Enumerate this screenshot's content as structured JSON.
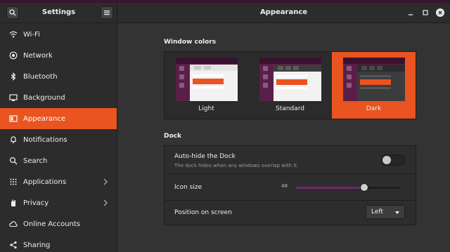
{
  "sidebar": {
    "title": "Settings",
    "items": [
      {
        "label": "Wi-Fi",
        "icon": "wifi-icon"
      },
      {
        "label": "Network",
        "icon": "network-icon"
      },
      {
        "label": "Bluetooth",
        "icon": "bluetooth-icon"
      },
      {
        "label": "Background",
        "icon": "background-icon"
      },
      {
        "label": "Appearance",
        "icon": "appearance-icon",
        "active": true
      },
      {
        "label": "Notifications",
        "icon": "bell-icon"
      },
      {
        "label": "Search",
        "icon": "search-icon"
      },
      {
        "label": "Applications",
        "icon": "applications-grid-icon",
        "chevron": true
      },
      {
        "label": "Privacy",
        "icon": "hand-icon",
        "chevron": true
      },
      {
        "label": "Online Accounts",
        "icon": "cloud-icon"
      },
      {
        "label": "Sharing",
        "icon": "share-icon"
      }
    ]
  },
  "main": {
    "title": "Appearance",
    "window_colors": {
      "heading": "Window colors",
      "themes": [
        {
          "label": "Light",
          "selected": false
        },
        {
          "label": "Standard",
          "selected": false
        },
        {
          "label": "Dark",
          "selected": true
        }
      ]
    },
    "dock": {
      "heading": "Dock",
      "autohide": {
        "title": "Auto-hide the Dock",
        "subtitle": "The dock hides when any windows overlap with it.",
        "enabled": false
      },
      "icon_size": {
        "label": "Icon size",
        "value": "48",
        "fraction": 0.66
      },
      "position": {
        "label": "Position on screen",
        "value": "Left"
      }
    }
  },
  "colors": {
    "accent": "#e95420",
    "aubergine": "#77216f",
    "sidebar_bg": "#2c2c2c",
    "content_bg": "#333333"
  }
}
